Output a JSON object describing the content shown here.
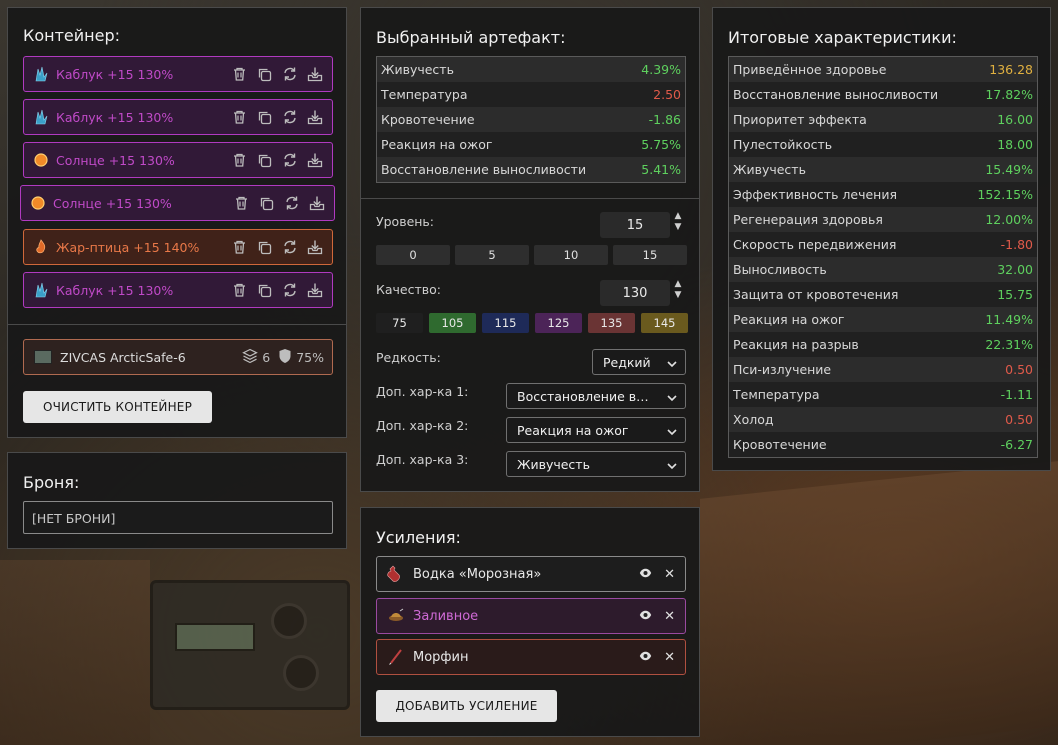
{
  "container": {
    "title": "Контейнер:",
    "slots": [
      {
        "name": "Каблук +15 130%",
        "icon": "crystal-icon"
      },
      {
        "name": "Каблук +15 130%",
        "icon": "crystal-icon"
      },
      {
        "name": "Солнце +15 130%",
        "icon": "sun-orb-icon"
      },
      {
        "name": "Солнце +15 130%",
        "icon": "sun-orb-icon"
      },
      {
        "name": "Жар-птица +15 140%",
        "icon": "firebird-icon"
      },
      {
        "name": "Каблук +15 130%",
        "icon": "crystal-icon"
      }
    ],
    "case": {
      "name": "ZIVCAS ArcticSafe-6",
      "slots": "6",
      "protection": "75%"
    },
    "clear_label": "ОЧИСТИТЬ КОНТЕЙНЕР"
  },
  "armor": {
    "title": "Броня:",
    "value": "[НЕТ БРОНИ]"
  },
  "artifact": {
    "title": "Выбранный артефакт:",
    "stats": [
      {
        "label": "Живучесть",
        "value": "4.39%",
        "tone": "pos"
      },
      {
        "label": "Температура",
        "value": "2.50",
        "tone": "neg"
      },
      {
        "label": "Кровотечение",
        "value": "-1.86",
        "tone": "pos"
      },
      {
        "label": "Реакция на ожог",
        "value": "5.75%",
        "tone": "pos"
      },
      {
        "label": "Восстановление выносливости",
        "value": "5.41%",
        "tone": "pos"
      }
    ],
    "level_label": "Уровень:",
    "level_value": "15",
    "level_presets": [
      "0",
      "5",
      "10",
      "15"
    ],
    "quality_label": "Качество:",
    "quality_value": "130",
    "quality_presets": [
      {
        "label": "75",
        "color": "#1f1f1f"
      },
      {
        "label": "105",
        "color": "#2f6a2f"
      },
      {
        "label": "115",
        "color": "#1e2a58"
      },
      {
        "label": "125",
        "color": "#4c2458"
      },
      {
        "label": "135",
        "color": "#6a3434"
      },
      {
        "label": "145",
        "color": "#6a5a1e"
      }
    ],
    "rarity_label": "Редкость:",
    "rarity_value": "Редкий",
    "extra1_label": "Доп. хар-ка 1:",
    "extra1_value": "Восстановление выносливости",
    "extra2_label": "Доп. хар-ка 2:",
    "extra2_value": "Реакция на ожог",
    "extra3_label": "Доп. хар-ка 3:",
    "extra3_value": "Живучесть"
  },
  "boosts": {
    "title": "Усиления:",
    "items": [
      {
        "name": "Водка «Морозная»",
        "icon": "vodka-bottle-icon"
      },
      {
        "name": "Заливное",
        "icon": "aspic-dish-icon"
      },
      {
        "name": "Морфин",
        "icon": "syringe-icon"
      }
    ],
    "add_label": "ДОБАВИТЬ УСИЛЕНИЕ"
  },
  "summary": {
    "title": "Итоговые характеристики:",
    "stats": [
      {
        "label": "Приведённое здоровье",
        "value": "136.28",
        "tone": "gold"
      },
      {
        "label": "Восстановление выносливости",
        "value": "17.82%",
        "tone": "pos"
      },
      {
        "label": "Приоритет эффекта",
        "value": "16.00",
        "tone": "pos"
      },
      {
        "label": "Пулестойкость",
        "value": "18.00",
        "tone": "pos"
      },
      {
        "label": "Живучесть",
        "value": "15.49%",
        "tone": "pos"
      },
      {
        "label": "Эффективность лечения",
        "value": "152.15%",
        "tone": "pos"
      },
      {
        "label": "Регенерация здоровья",
        "value": "12.00%",
        "tone": "pos"
      },
      {
        "label": "Скорость передвижения",
        "value": "-1.80",
        "tone": "neg"
      },
      {
        "label": "Выносливость",
        "value": "32.00",
        "tone": "pos"
      },
      {
        "label": "Защита от кровотечения",
        "value": "15.75",
        "tone": "pos"
      },
      {
        "label": "Реакция на ожог",
        "value": "11.49%",
        "tone": "pos"
      },
      {
        "label": "Реакция на разрыв",
        "value": "22.31%",
        "tone": "pos"
      },
      {
        "label": "Пси-излучение",
        "value": "0.50",
        "tone": "neg"
      },
      {
        "label": "Температура",
        "value": "-1.11",
        "tone": "pos"
      },
      {
        "label": "Холод",
        "value": "0.50",
        "tone": "neg"
      },
      {
        "label": "Кровотечение",
        "value": "-6.27",
        "tone": "pos"
      }
    ]
  }
}
